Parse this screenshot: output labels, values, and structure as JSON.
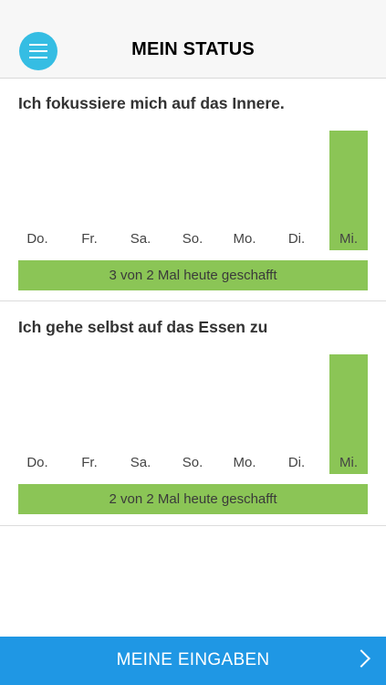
{
  "header": {
    "title": "MEIN STATUS",
    "menu_icon": "hamburger-menu-icon"
  },
  "colors": {
    "accent": "#35bde3",
    "progress": "#8bc556",
    "footer": "#1f97e4"
  },
  "habits": [
    {
      "title": "Ich fokussiere mich auf das Innere.",
      "days": [
        "Do.",
        "Fr.",
        "Sa.",
        "So.",
        "Mo.",
        "Di.",
        "Mi."
      ],
      "active_day_index": 6,
      "progress_text": "3 von 2 Mal heute geschafft"
    },
    {
      "title": "Ich gehe selbst auf das Essen zu",
      "days": [
        "Do.",
        "Fr.",
        "Sa.",
        "So.",
        "Mo.",
        "Di.",
        "Mi."
      ],
      "active_day_index": 6,
      "progress_text": "2 von 2 Mal heute geschafft"
    }
  ],
  "footer": {
    "label": "MEINE EINGABEN",
    "arrow_icon": "chevron-right-icon"
  }
}
